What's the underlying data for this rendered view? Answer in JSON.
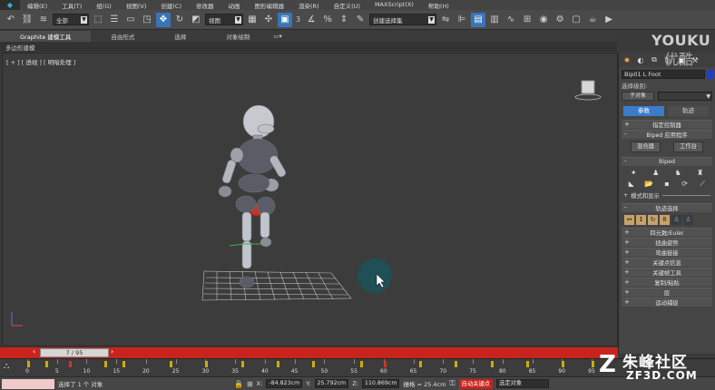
{
  "menubar": {
    "items": [
      "编辑(E)",
      "工具(T)",
      "组(G)",
      "视图(V)",
      "创建(C)",
      "修改器",
      "动画",
      "图形编辑器",
      "渲染(R)",
      "自定义(U)",
      "MAXScript(X)",
      "帮助(H)"
    ]
  },
  "toolbar": {
    "selection_filter": "全部",
    "ref_coord": "视图",
    "named_set": "创建选择集"
  },
  "ribbon": {
    "tabs": [
      "Graphite 建模工具",
      "自由形式",
      "选择",
      "对象绘制"
    ],
    "sub_label": "多边形建模"
  },
  "viewport": {
    "label": "[ + ] [ 透视 ] [ 明暗处理 ]"
  },
  "command_panel": {
    "object_name": "Bip01 L Foot",
    "object_color": "#1a3fd0",
    "selection_level_label": "选择级别:",
    "sub_object_label": "子对象",
    "tabs": [
      "参数",
      "轨迹"
    ],
    "rollouts": {
      "assign_controller": "指定控制器",
      "biped_app": "Biped 应用程序",
      "biped": "Biped",
      "mode_display": "模式和显示",
      "track_selection": "轨迹选择",
      "quaternion": "四元数/Euler",
      "twist_poses": "扭曲姿势",
      "bend_links": "弯曲链接",
      "key_info": "关键点信息",
      "key_tools": "关键帧工具",
      "copy_paste": "复制/粘贴",
      "layers": "层",
      "motion_capture": "运动捕捉"
    },
    "buttons": {
      "mixer": "混合器",
      "workbench": "工作台"
    }
  },
  "timeline": {
    "slider_label": "7 / 95",
    "ticks": [
      "0",
      "5",
      "10",
      "15",
      "20",
      "25",
      "30",
      "35",
      "40",
      "45",
      "50",
      "55",
      "60",
      "65",
      "70",
      "75",
      "80",
      "85",
      "90",
      "95"
    ]
  },
  "statusbar": {
    "selection_text": "选择了 1 个 对象",
    "x_label": "X:",
    "x_value": "-84.823cm",
    "y_label": "Y:",
    "y_value": "25.792cm",
    "z_label": "Z:",
    "z_value": "110.869cm",
    "grid": "栅格 = 25.4cm",
    "auto_key": "自动关键点",
    "selected_object": "选定对象"
  },
  "watermarks": {
    "youku": "YOUKU",
    "youku_cn": "优酷",
    "zf_cn": "朱峰社区",
    "zf_en": "ZF3D.COM"
  }
}
